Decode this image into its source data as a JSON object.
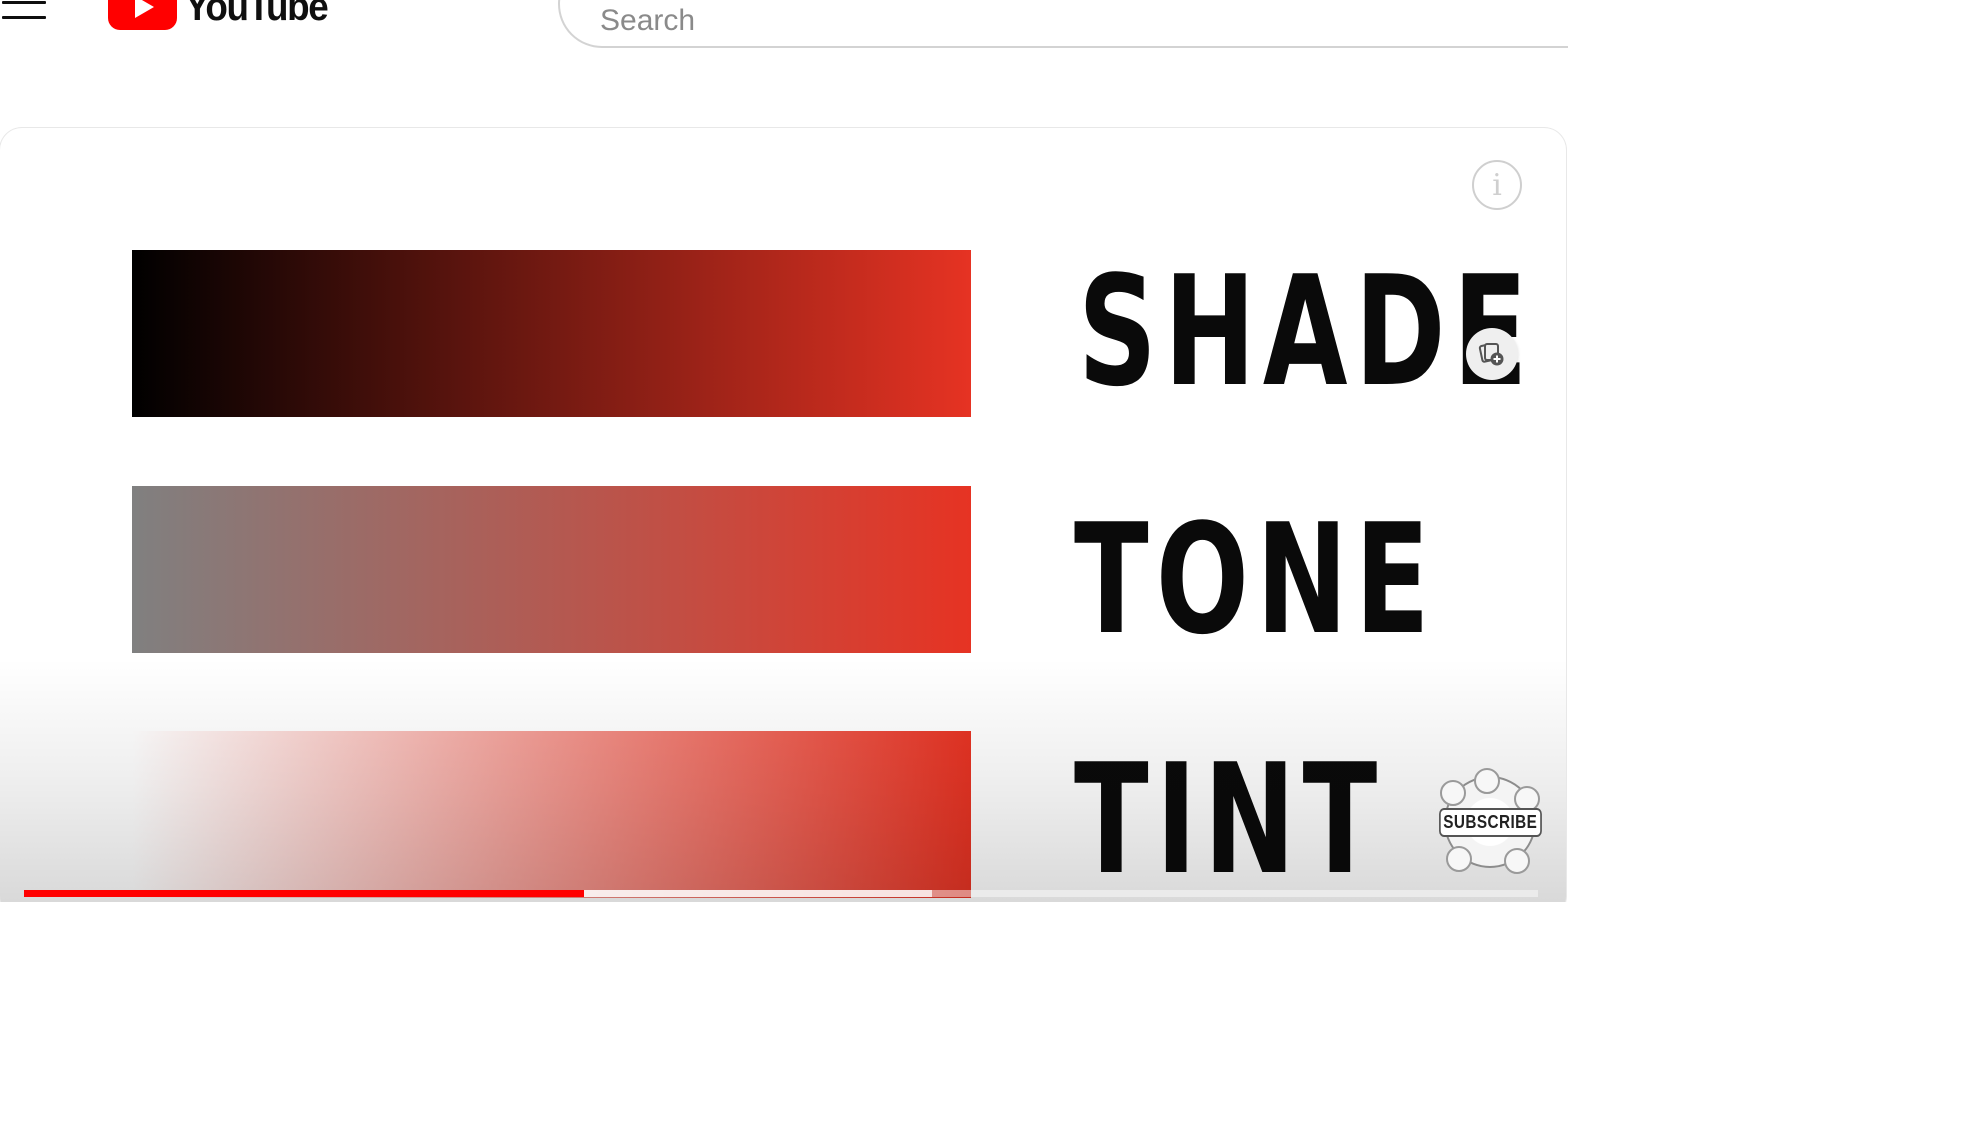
{
  "masthead": {
    "menu_icon": "hamburger-menu-icon",
    "logo_text": "YouTube",
    "search_placeholder": "Search",
    "search_value": ""
  },
  "video": {
    "gradients": [
      {
        "label": "SHADE",
        "from": "#000000",
        "to": "#e63323"
      },
      {
        "label": "TONE",
        "from": "#808080",
        "to": "#e63323"
      },
      {
        "label": "TINT",
        "from": "#ffffff",
        "to": "#e63323"
      }
    ],
    "info_icon": "info-icon",
    "save_icon": "save-to-playlist-icon",
    "subscribe_badge_text": "SUBSCRIBE"
  },
  "player": {
    "progress_played": 0.37,
    "progress_buffered": 0.6
  },
  "colors": {
    "brand_red": "#ff0000",
    "accent_red": "#e63323",
    "text": "#0a0a0a"
  }
}
